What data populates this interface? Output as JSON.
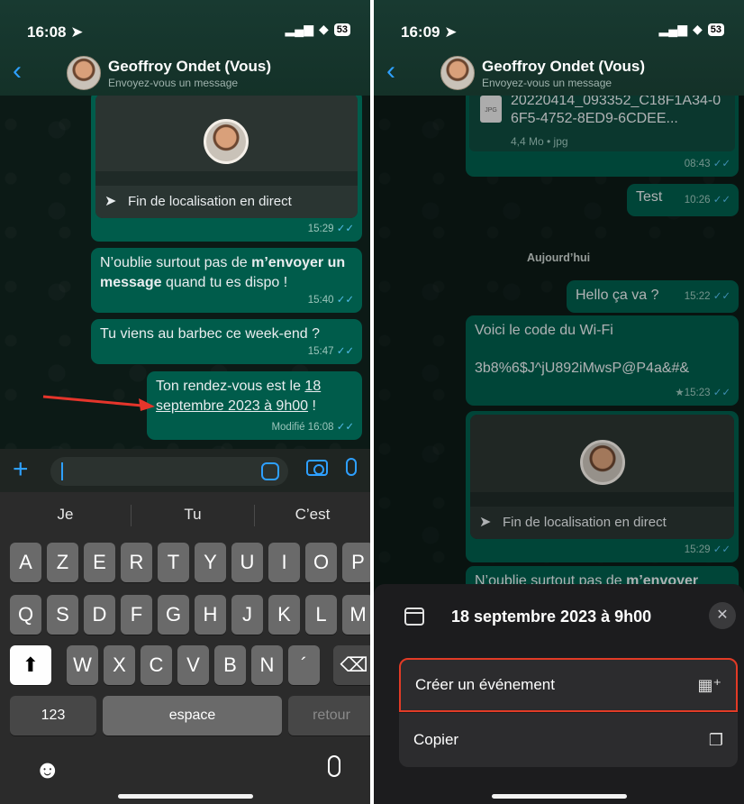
{
  "left": {
    "status": {
      "time": "16:08",
      "battery": "53"
    },
    "header": {
      "name": "Geoffroy Ondet (Vous)",
      "subtitle": "Envoyez-vous un message"
    },
    "location": {
      "label": "Fin de localisation en direct",
      "time": "15:29"
    },
    "messages": [
      {
        "pre": "N’oublie surtout pas de ",
        "bold": "m’envoyer un message",
        "post": " quand tu es dispo !",
        "time": "15:40"
      },
      {
        "text": "Tu viens au barbec ce week-end ?",
        "time": "15:47"
      },
      {
        "pre": "Ton rendez-vous est le ",
        "link": "18 septembre 2023 à 9h00",
        "post": " !",
        "edited": "Modifié",
        "time": "16:08"
      }
    ],
    "suggestions": [
      "Je",
      "Tu",
      "C’est"
    ],
    "keys": {
      "row1": [
        "A",
        "Z",
        "E",
        "R",
        "T",
        "Y",
        "U",
        "I",
        "O",
        "P"
      ],
      "row2": [
        "Q",
        "S",
        "D",
        "F",
        "G",
        "H",
        "J",
        "K",
        "L",
        "M"
      ],
      "row3": [
        "W",
        "X",
        "C",
        "V",
        "B",
        "N",
        "´"
      ],
      "numbers": "123",
      "space": "espace",
      "return": "retour"
    }
  },
  "right": {
    "status": {
      "time": "16:09",
      "battery": "53"
    },
    "header": {
      "name": "Geoffroy Ondet (Vous)",
      "subtitle": "Envoyez-vous un message"
    },
    "file": {
      "name": "20220414_093352_C18F1A34-06F5-4752-8ED9-6CDEE...",
      "info": "4,4 Mo • jpg",
      "type": "JPG",
      "time": "08:43"
    },
    "test": {
      "text": "Test",
      "time": "10:26"
    },
    "day": "Aujourd’hui",
    "hello": {
      "text": "Hello ça va ?",
      "time": "15:22"
    },
    "wifi": {
      "line1": "Voici le code du Wi-Fi",
      "line2": "3b8%6$J^jU892iMwsP@P4a&#&",
      "time": "★15:23"
    },
    "location": {
      "label": "Fin de localisation en direct",
      "time": "15:29"
    },
    "partial": {
      "pre": "N’oublie surtout pas de ",
      "bold": "m’envoyer"
    },
    "sheet": {
      "title": "18 septembre 2023 à 9h00",
      "create": "Créer un événement",
      "copy": "Copier"
    }
  }
}
